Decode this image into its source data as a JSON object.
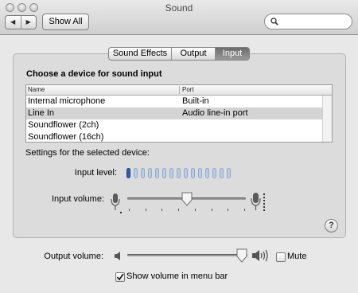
{
  "window": {
    "title": "Sound"
  },
  "toolbar": {
    "back_icon": "back-arrow-icon",
    "forward_icon": "forward-arrow-icon",
    "show_all_label": "Show All",
    "search_value": "",
    "search_icon": "magnifier-icon"
  },
  "tabs": [
    {
      "label": "Sound Effects",
      "selected": false
    },
    {
      "label": "Output",
      "selected": false
    },
    {
      "label": "Input",
      "selected": true
    }
  ],
  "input_pane": {
    "choose_label": "Choose a device for sound input",
    "table": {
      "columns": [
        "Name",
        "Port"
      ],
      "rows": [
        {
          "name": "Internal microphone",
          "port": "Built-in",
          "selected": false
        },
        {
          "name": "Line In",
          "port": "Audio line-in port",
          "selected": true
        },
        {
          "name": "Soundflower (2ch)",
          "port": "",
          "selected": false
        },
        {
          "name": "Soundflower (16ch)",
          "port": "",
          "selected": false
        }
      ]
    },
    "settings_label": "Settings for the selected device:",
    "input_level_label": "Input level:",
    "input_level": {
      "segments": 15,
      "lit": 1
    },
    "input_volume_label": "Input volume:",
    "input_volume_fraction": 0.5,
    "help_label": "?"
  },
  "output": {
    "volume_label": "Output volume:",
    "volume_fraction": 1.0,
    "mute_label": "Mute",
    "mute_checked": false,
    "show_in_menubar_label": "Show volume in menu bar",
    "show_in_menubar_checked": true
  },
  "colors": {
    "level_on": "#2d5fb0",
    "level_off": "#b9cde6",
    "selected_row": "#d4d4d4"
  }
}
